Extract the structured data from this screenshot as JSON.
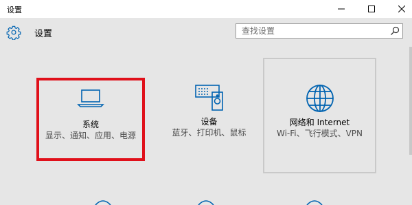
{
  "window": {
    "title": "设置",
    "controls": {
      "minimize": "minimize-icon",
      "maximize": "maximize-icon",
      "close": "close-icon"
    }
  },
  "header": {
    "icon": "gear-icon",
    "title": "设置"
  },
  "search": {
    "placeholder": "查找设置",
    "icon": "search-icon"
  },
  "tiles": [
    {
      "icon": "laptop-icon",
      "name": "系统",
      "desc": "显示、通知、应用、电源",
      "highlighted": true
    },
    {
      "icon": "devices-icon",
      "name": "设备",
      "desc": "蓝牙、打印机、鼠标"
    },
    {
      "icon": "globe-icon",
      "name": "网络和 Internet",
      "desc": "Wi-Fi、飞行模式、VPN"
    }
  ],
  "colors": {
    "accent": "#0063b1",
    "highlight_border": "#e0101a",
    "background": "#e6e6e6"
  }
}
